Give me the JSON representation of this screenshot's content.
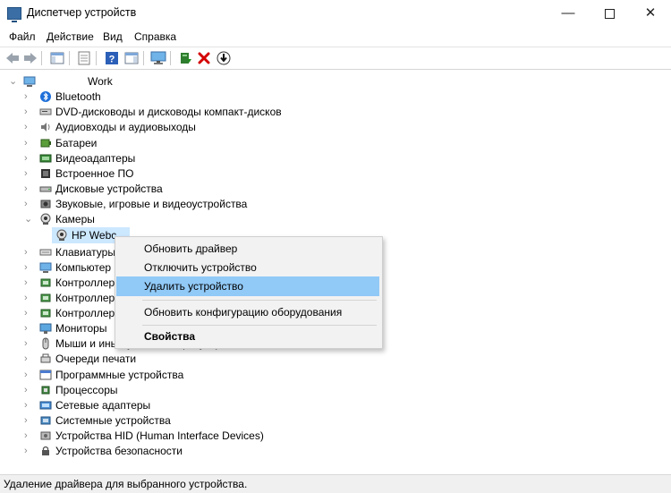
{
  "window": {
    "title": "Диспетчер устройств",
    "minimize": "—",
    "close": "✕"
  },
  "menu": [
    "Файл",
    "Действие",
    "Вид",
    "Справка"
  ],
  "tree": {
    "root": "Work",
    "categories": [
      "Bluetooth",
      "DVD-дисководы и дисководы компакт-дисков",
      "Аудиовходы и аудиовыходы",
      "Батареи",
      "Видеоадаптеры",
      "Встроенное ПО",
      "Дисковые устройства",
      "Звуковые, игровые и видеоустройства",
      "Камеры",
      "Клавиатуры",
      "Компьютер",
      "Контроллер",
      "Контроллер",
      "Контроллер",
      "Мониторы",
      "Мыши и иные указывающие устройства",
      "Очереди печати",
      "Программные устройства",
      "Процессоры",
      "Сетевые адаптеры",
      "Системные устройства",
      "Устройства HID (Human Interface Devices)",
      "Устройства безопасности"
    ],
    "selected_child": "HP Webc"
  },
  "context_menu": {
    "items": [
      "Обновить драйвер",
      "Отключить устройство",
      "Удалить устройство",
      "Обновить конфигурацию оборудования",
      "Свойства"
    ],
    "highlighted_index": 2
  },
  "status_bar": "Удаление драйвера для выбранного устройства.",
  "colors": {
    "selection": "#cce8ff",
    "menu_highlight": "#91c9f7",
    "delete_red": "#d40000"
  }
}
